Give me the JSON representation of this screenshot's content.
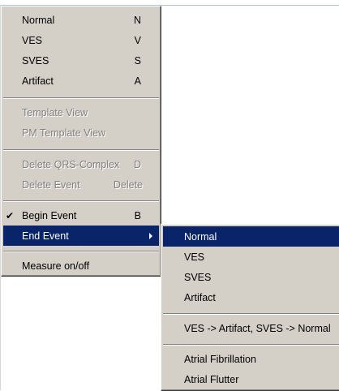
{
  "main_menu": {
    "normal": {
      "label": "Normal",
      "shortcut": "N"
    },
    "ves": {
      "label": "VES",
      "shortcut": "V"
    },
    "sves": {
      "label": "SVES",
      "shortcut": "S"
    },
    "artifact": {
      "label": "Artifact",
      "shortcut": "A"
    },
    "template_view": {
      "label": "Template View"
    },
    "pm_template_view": {
      "label": "PM Template View"
    },
    "delete_qrs": {
      "label": "Delete QRS-Complex",
      "shortcut": "D"
    },
    "delete_event": {
      "label": "Delete Event",
      "shortcut": "Delete"
    },
    "begin_event": {
      "label": "Begin Event",
      "shortcut": "B",
      "check": "✔"
    },
    "end_event": {
      "label": "End Event"
    },
    "measure": {
      "label": "Measure on/off"
    }
  },
  "submenu": {
    "normal": "Normal",
    "ves": "VES",
    "sves": "SVES",
    "artifact": "Artifact",
    "ves_to_artifact": "VES -> Artifact, SVES -> Normal",
    "atrial_fibrillation": "Atrial Fibrillation",
    "atrial_flutter": "Atrial Flutter"
  },
  "colors": {
    "menu_bg": "#d4d0c8",
    "highlight": "#0a246a",
    "disabled_text": "#808080"
  }
}
